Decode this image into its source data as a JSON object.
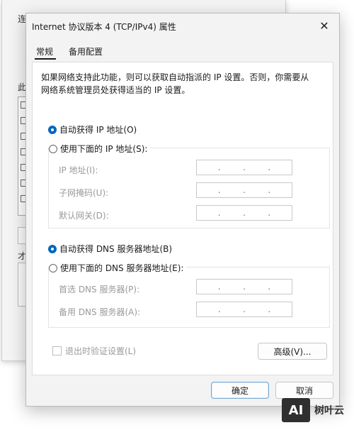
{
  "background_window": {
    "frag_top": "连",
    "frag_mid": "此",
    "frag_low": "才"
  },
  "dialog": {
    "title": "Internet 协议版本 4 (TCP/IPv4) 属性",
    "close_glyph": "✕",
    "tabs": [
      "常规",
      "备用配置"
    ],
    "description": "如果网络支持此功能，则可以获取自动指派的 IP 设置。否则，你需要从网络系统管理员处获得适当的 IP 设置。",
    "ip_section": {
      "auto_label": "自动获得 IP 地址(O)",
      "manual_label": "使用下面的 IP 地址(S):",
      "fields": [
        "IP 地址(I):",
        "子网掩码(U):",
        "默认网关(D):"
      ],
      "selected": "auto"
    },
    "dns_section": {
      "auto_label": "自动获得 DNS 服务器地址(B)",
      "manual_label": "使用下面的 DNS 服务器地址(E):",
      "fields": [
        "首选 DNS 服务器(P):",
        "备用 DNS 服务器(A):"
      ],
      "selected": "auto"
    },
    "ip_dot": ".",
    "validate_label": "退出时验证设置(L)",
    "advanced_label": "高级(V)...",
    "ok_label": "确定",
    "cancel_label": "取消"
  },
  "watermark": {
    "logo": "AI",
    "text": "树叶云"
  },
  "colors": {
    "accent": "#0067c0",
    "disabled_text": "#9a9a9a"
  }
}
